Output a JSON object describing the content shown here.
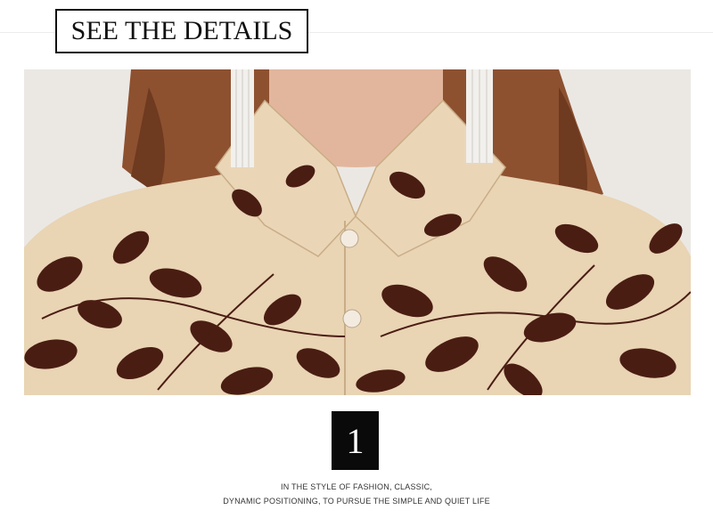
{
  "header": {
    "title": "SEE THE DETAILS"
  },
  "photo": {
    "subject": "fabric-detail-photo"
  },
  "badge": {
    "number": "1"
  },
  "caption": {
    "line1": "IN THE STYLE OF FASHION, CLASSIC,",
    "line2": "DYNAMIC POSITIONING, TO PURSUE THE SIMPLE AND QUIET LIFE"
  },
  "colors": {
    "fabric_base": "#e9d4b4",
    "print": "#4a1d13",
    "hair": "#8a4e2c",
    "background": "#ffffff"
  }
}
